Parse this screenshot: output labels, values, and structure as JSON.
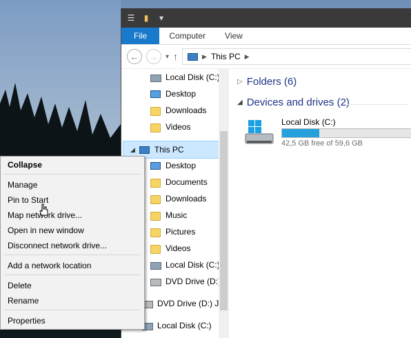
{
  "ribbon": {
    "file": "File",
    "computer": "Computer",
    "view": "View"
  },
  "address": {
    "path": "This PC"
  },
  "nav": {
    "items": [
      {
        "label": "Local Disk (C:)",
        "icon": "drive-icon"
      },
      {
        "label": "Desktop",
        "icon": "desktop-icon"
      },
      {
        "label": "Downloads",
        "icon": "downloads-folder-icon"
      },
      {
        "label": "Videos",
        "icon": "videos-folder-icon"
      },
      {
        "label": "This PC",
        "icon": "computer-icon"
      },
      {
        "label": "Desktop",
        "icon": "desktop-icon"
      },
      {
        "label": "Documents",
        "icon": "documents-folder-icon"
      },
      {
        "label": "Downloads",
        "icon": "downloads-folder-icon"
      },
      {
        "label": "Music",
        "icon": "music-folder-icon"
      },
      {
        "label": "Pictures",
        "icon": "pictures-folder-icon"
      },
      {
        "label": "Videos",
        "icon": "videos-folder-icon"
      },
      {
        "label": "Local Disk (C:)",
        "icon": "drive-icon"
      },
      {
        "label": "DVD Drive (D:)",
        "icon": "dvd-drive-icon"
      },
      {
        "label": "DVD Drive (D:) JM",
        "icon": "dvd-drive-icon"
      },
      {
        "label": "Local Disk (C:)",
        "icon": "drive-icon"
      }
    ]
  },
  "main": {
    "folders_header": "Folders (6)",
    "devices_header": "Devices and drives (2)",
    "drive": {
      "name": "Local Disk (C:)",
      "free": "42,5 GB free of 59,6 GB",
      "used_fraction": 0.29
    }
  },
  "menu": {
    "collapse": "Collapse",
    "manage": "Manage",
    "pin": "Pin to Start",
    "map": "Map network drive...",
    "open": "Open in new window",
    "disconnect": "Disconnect network drive...",
    "add": "Add a network location",
    "delete": "Delete",
    "rename": "Rename",
    "properties": "Properties"
  }
}
